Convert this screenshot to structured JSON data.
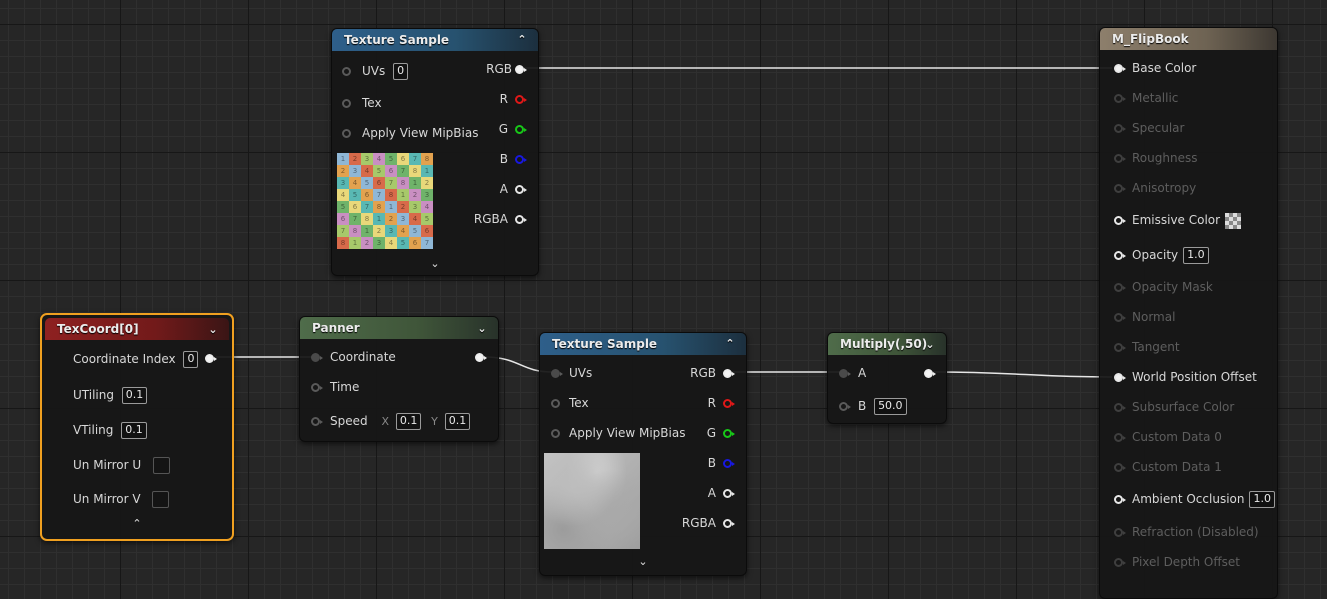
{
  "nodes": {
    "texture_sample_top": {
      "title": "Texture Sample",
      "inputs": {
        "uvs": "UVs",
        "uvs_value": "0",
        "tex": "Tex",
        "mip": "Apply View MipBias"
      },
      "outputs": {
        "rgb": "RGB",
        "r": "R",
        "g": "G",
        "b": "B",
        "a": "A",
        "rgba": "RGBA"
      },
      "thumbnail_numbers": [
        "1",
        "2",
        "3",
        "4",
        "5",
        "6",
        "7",
        "8",
        "2",
        "3",
        "4",
        "5",
        "6",
        "7",
        "8",
        "1",
        "3",
        "4",
        "5",
        "6",
        "7",
        "8",
        "1",
        "2",
        "4",
        "5",
        "6",
        "7",
        "8",
        "1",
        "2",
        "3",
        "5",
        "6",
        "7",
        "8",
        "1",
        "2",
        "3",
        "4",
        "6",
        "7",
        "8",
        "1",
        "2",
        "3",
        "4",
        "5",
        "7",
        "8",
        "1",
        "2",
        "3",
        "4",
        "5",
        "6",
        "8",
        "1",
        "2",
        "3",
        "4",
        "5",
        "6",
        "7"
      ]
    },
    "texcoord": {
      "title": "TexCoord[0]",
      "coordinate_index_label": "Coordinate Index",
      "coordinate_index_value": "0",
      "utiling_label": "UTiling",
      "utiling_value": "0.1",
      "vtiling_label": "VTiling",
      "vtiling_value": "0.1",
      "unmirror_u_label": "Un Mirror U",
      "unmirror_v_label": "Un Mirror V"
    },
    "panner": {
      "title": "Panner",
      "coordinate_label": "Coordinate",
      "time_label": "Time",
      "speed_label": "Speed",
      "x_label": "X",
      "x_value": "0.1",
      "y_label": "Y",
      "y_value": "0.1"
    },
    "texture_sample_bottom": {
      "title": "Texture Sample",
      "inputs": {
        "uvs": "UVs",
        "tex": "Tex",
        "mip": "Apply View MipBias"
      },
      "outputs": {
        "rgb": "RGB",
        "r": "R",
        "g": "G",
        "b": "B",
        "a": "A",
        "rgba": "RGBA"
      }
    },
    "multiply": {
      "title": "Multiply(,50)",
      "a_label": "A",
      "b_label": "B",
      "b_value": "50.0"
    },
    "material": {
      "title": "M_FlipBook",
      "pins": [
        {
          "label": "Base Color",
          "state": "active",
          "connected": true
        },
        {
          "label": "Metallic",
          "state": "disabled"
        },
        {
          "label": "Specular",
          "state": "disabled"
        },
        {
          "label": "Roughness",
          "state": "disabled"
        },
        {
          "label": "Anisotropy",
          "state": "disabled"
        },
        {
          "label": "Emissive Color",
          "state": "active",
          "swatch": "checker-icon"
        },
        {
          "label": "Opacity",
          "state": "active",
          "value": "1.0"
        },
        {
          "label": "Opacity Mask",
          "state": "disabled"
        },
        {
          "label": "Normal",
          "state": "disabled"
        },
        {
          "label": "Tangent",
          "state": "disabled"
        },
        {
          "label": "World Position Offset",
          "state": "active",
          "connected": true
        },
        {
          "label": "Subsurface Color",
          "state": "disabled"
        },
        {
          "label": "Custom Data 0",
          "state": "disabled"
        },
        {
          "label": "Custom Data 1",
          "state": "disabled"
        },
        {
          "label": "Ambient Occlusion",
          "state": "active",
          "value": "1.0"
        },
        {
          "label": "Refraction (Disabled)",
          "state": "disabled"
        },
        {
          "label": "Pixel Depth Offset",
          "state": "disabled"
        }
      ]
    }
  },
  "colors": {
    "pin_r": "#e01818",
    "pin_g": "#18c818",
    "pin_b": "#1818e0",
    "selection": "#f0a020",
    "wire": "#e6e6e6"
  }
}
